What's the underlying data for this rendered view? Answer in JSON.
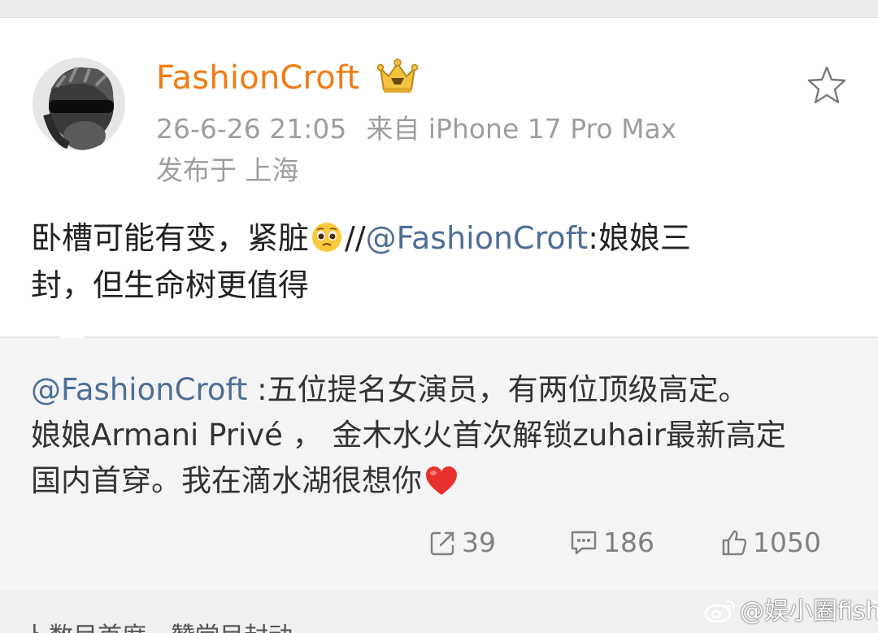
{
  "post": {
    "username": "FashionCroft",
    "timestamp": "26-6-26 21:05",
    "source": "来自 iPhone 17 Pro Max",
    "location": "发布于 上海",
    "text_part1": "卧槽可能有变，紧脏",
    "text_part2": "//",
    "mention": "@FashionCroft",
    "text_part3": ":娘娘三",
    "text_line2": "封，但生命树更值得"
  },
  "quote": {
    "mention": "@FashionCroft",
    "line1_rest": " :五位提名女演员，有两位顶级高定。",
    "line2": "娘娘Armani Privé ， 金木水火首次解锁zuhair最新高定",
    "line3": "国内首穿。我在滴水湖很想你"
  },
  "stats": {
    "reposts": "39",
    "comments": "186",
    "likes": "1050"
  },
  "footer": {
    "cut_text": "卜数目首席，赞堂目封动"
  },
  "watermark": {
    "text": "@娱小圈fish"
  },
  "colors": {
    "username": "#f07c14",
    "mention": "#4e6f96",
    "meta": "#9e9e9e",
    "heart": "#e8312f"
  }
}
